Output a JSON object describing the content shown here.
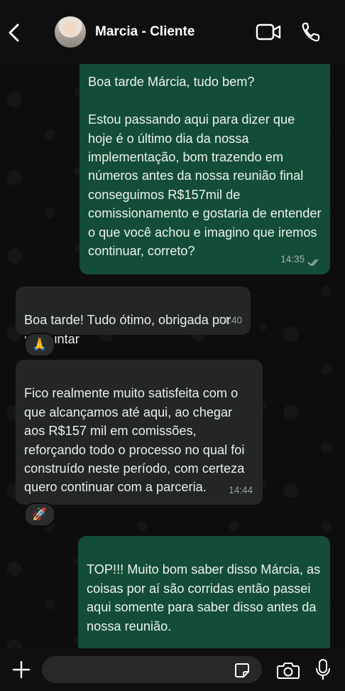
{
  "header": {
    "contact_name": "Marcia - Cliente"
  },
  "messages": [
    {
      "direction": "outgoing",
      "text": "Boa tarde Márcia, tudo bem?\n\nEstou passando aqui para dizer que hoje é o último dia da nossa implementação, bom trazendo em números antes da nossa reunião final conseguimos R$157mil de comissionamento e gostaria de entender o que você achou e imagino que iremos continuar, correto?",
      "time": "14:35",
      "status": "read"
    },
    {
      "direction": "incoming",
      "text": "Boa tarde! Tudo ótimo, obrigada por perguntar",
      "time": "14:40",
      "reaction": "🙏"
    },
    {
      "direction": "incoming",
      "text": "Fico realmente muito satisfeita com o que alcançamos até aqui, ao chegar aos R$157 mil em comissões, reforçando todo o processo no qual foi construído neste período, com certeza quero continuar com a parceria.",
      "time": "14:44",
      "reaction": "🚀"
    },
    {
      "direction": "outgoing",
      "text": "TOP!!! Muito bom saber disso Márcia, as coisas por aí são corridas então passei aqui somente para saber disso  antes da nossa reunião.",
      "time": ""
    }
  ],
  "composer": {
    "value": "",
    "placeholder": ""
  },
  "colors": {
    "outgoing_bubble": "#144d37",
    "incoming_bubble": "#242626",
    "background": "#0b0b0b"
  },
  "icons": [
    "back-arrow-icon",
    "video-call-icon",
    "phone-icon",
    "plus-icon",
    "sticker-icon",
    "camera-icon",
    "microphone-icon",
    "read-ticks-icon"
  ]
}
